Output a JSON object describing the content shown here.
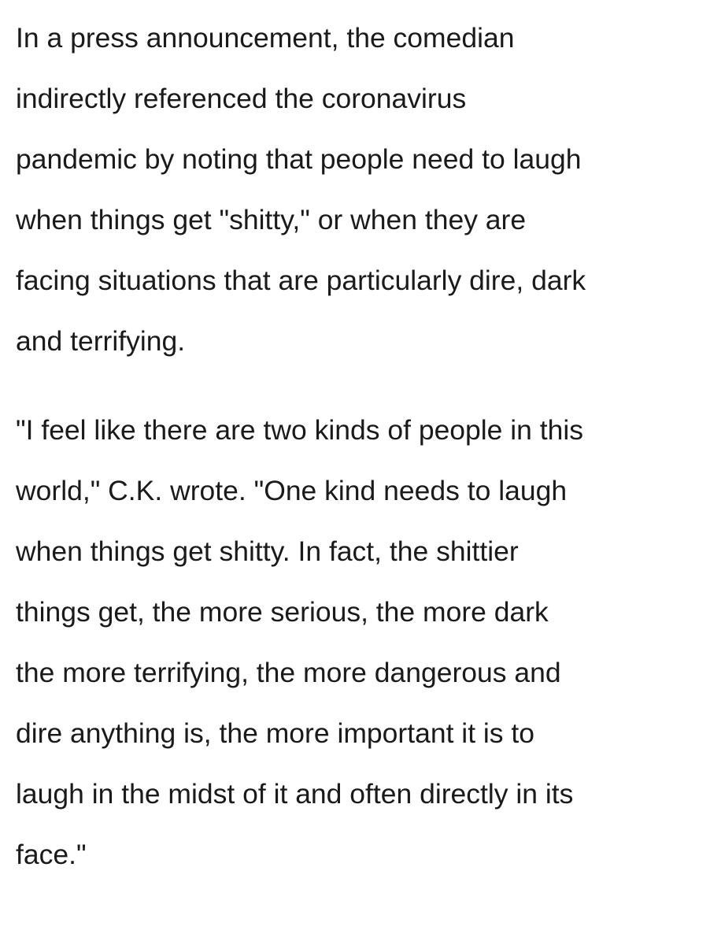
{
  "article": {
    "paragraphs": [
      "In a press announcement, the comedian\nindirectly referenced the coronavirus\npandemic by noting that people need to laugh\nwhen things get \"shitty,\" or when they are\nfacing situations that are particularly dire, dark\nand terrifying.",
      "\"I feel like there are two kinds of people in this\nworld,\" C.K. wrote. \"One kind needs to laugh\nwhen things get shitty. In fact, the shittier\nthings get, the more serious, the more dark\nthe more terrifying, the more dangerous and\ndire anything is, the more important it is to\nlaugh in the midst of it and often directly in its\nface.\""
    ]
  }
}
